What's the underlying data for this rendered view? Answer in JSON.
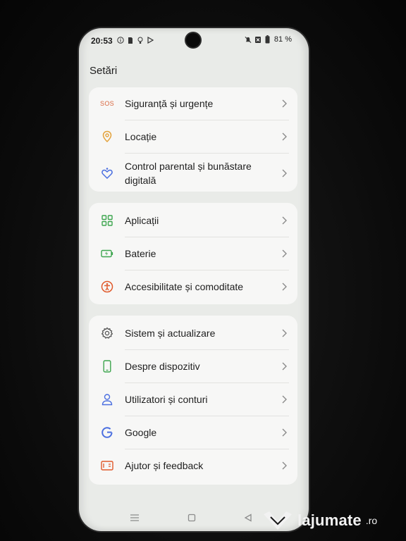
{
  "status_bar": {
    "time": "20:53",
    "battery": "81 %"
  },
  "page": {
    "title": "Setări"
  },
  "groups": [
    {
      "items": [
        {
          "label": "Siguranță și urgențe",
          "icon": "sos-icon",
          "icon_text": "SOS",
          "color": "#d9663e"
        },
        {
          "label": "Locație",
          "icon": "location-pin-icon",
          "color": "#e3a23b"
        },
        {
          "label": "Control parental și bunăstare digitală",
          "icon": "family-hearts-icon",
          "color": "#4b6fe0"
        }
      ]
    },
    {
      "items": [
        {
          "label": "Aplicații",
          "icon": "apps-grid-icon",
          "color": "#3da54e"
        },
        {
          "label": "Baterie",
          "icon": "battery-icon",
          "color": "#3da54e"
        },
        {
          "label": "Accesibilitate și comoditate",
          "icon": "accessibility-icon",
          "color": "#e05a2b"
        }
      ]
    },
    {
      "items": [
        {
          "label": "Sistem și actualizare",
          "icon": "gear-icon",
          "color": "#555555"
        },
        {
          "label": "Despre dispozitiv",
          "icon": "phone-device-icon",
          "color": "#3da54e"
        },
        {
          "label": "Utilizatori și conturi",
          "icon": "user-icon",
          "color": "#4b6fe0"
        },
        {
          "label": "Google",
          "icon": "google-icon",
          "color": "#4b6fe0"
        },
        {
          "label": "Ajutor și feedback",
          "icon": "help-feedback-icon",
          "color": "#e05a2b"
        }
      ]
    }
  ],
  "watermark": {
    "brand": "lajumate",
    "suffix": ".ro"
  }
}
